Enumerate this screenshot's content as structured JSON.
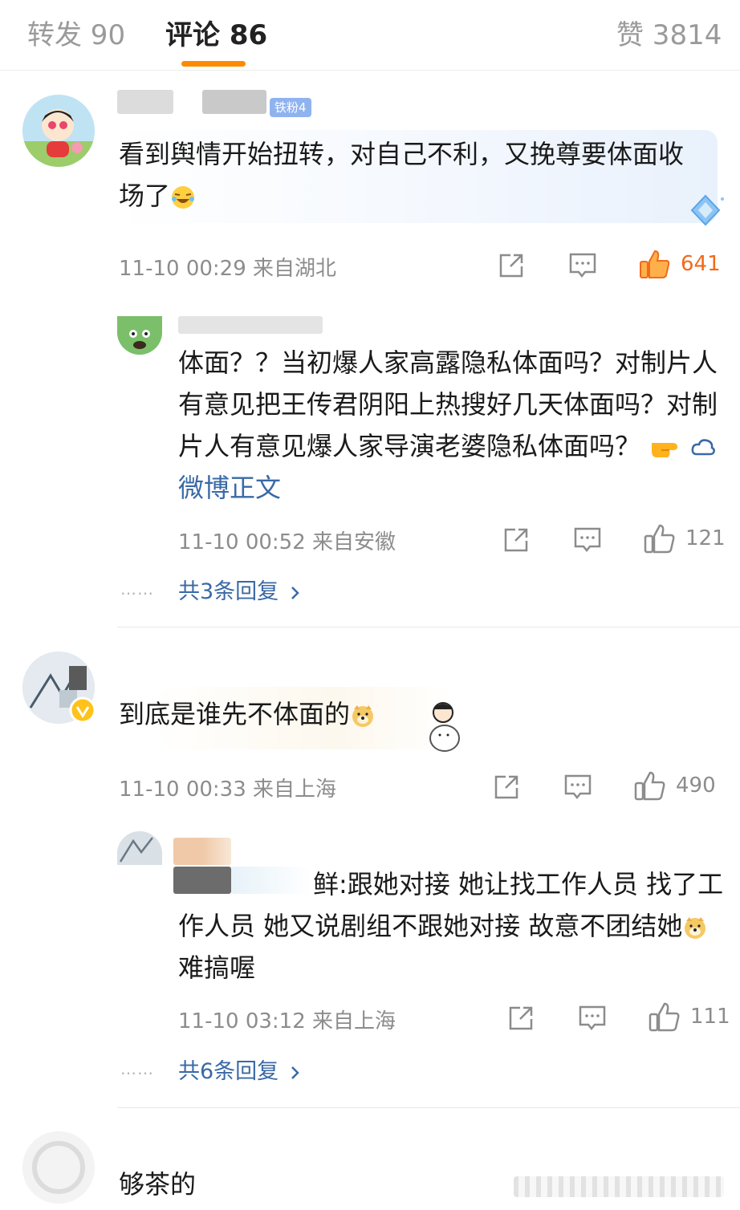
{
  "tabs": {
    "repost": "转发 90",
    "comments": "评论 86",
    "likes": "赞 3814"
  },
  "comments": [
    {
      "fan_badge": "铁粉4",
      "text": "看到舆情开始扭转，对自己不利，又挽尊要体面收场了",
      "time": "11-10 00:29",
      "location": "来自湖北",
      "likes": "641",
      "reply": {
        "text_before_link": "体面？？当初爆人家高露隐私体面吗？对制片人有意见把王传君阴阳上热搜好几天体面吗？对制片人有意见爆人家导演老婆隐私体面吗？",
        "link": "微博正文",
        "time": "11-10 00:52",
        "location": "来自安徽",
        "likes": "121"
      },
      "more_replies": "共3条回复"
    },
    {
      "text": "到底是谁先不体面的",
      "time": "11-10 00:33",
      "location": "来自上海",
      "likes": "490",
      "reply": {
        "text": "鲜:跟她对接 她让找工作人员 找了工作人员 她又说剧组不跟她对接 故意不团结她",
        "text_tail": "难搞喔",
        "time": "11-10 03:12",
        "location": "来自上海",
        "likes": "111"
      },
      "more_replies": "共6条回复"
    },
    {
      "text": "够茶的"
    }
  ],
  "colors": {
    "accent": "#ff8a00",
    "link": "#3a69a6",
    "hot_like": "#f2691b",
    "meta": "#8c8c8c"
  },
  "icons": [
    "repost-icon",
    "comment-icon",
    "like-icon",
    "chevron-right-icon",
    "diamond-decoration-icon"
  ]
}
